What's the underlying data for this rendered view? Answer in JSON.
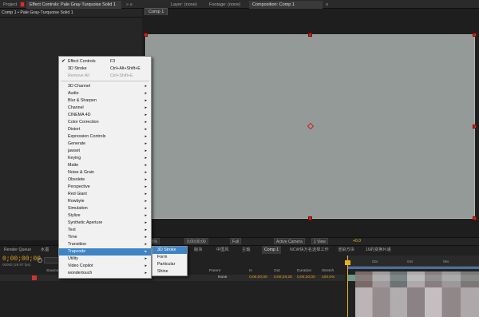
{
  "top_tabs": {
    "project": "Project",
    "effect_controls": "Effect Controls: Pale Gray-Turquoise Solid 1",
    "effect_controls_extra": "» ≡",
    "layer": "Layer: (none)",
    "footage": "Footage: (none)",
    "composition": "Composition: Comp 1",
    "composition_extra": "≡"
  },
  "breadcrumb": "Comp 1 • Pale Gray-Turquoise Solid 1",
  "comp_subtab": "Comp 1",
  "context_menu": {
    "top_items": [
      {
        "label": "Effect Controls",
        "shortcut": "F3",
        "checked": true,
        "disabled": false
      },
      {
        "label": "3D Stroke",
        "shortcut": "Ctrl+Alt+Shift+E",
        "checked": false,
        "disabled": false
      },
      {
        "label": "Remove All",
        "shortcut": "Ctrl+Shift+E",
        "checked": false,
        "disabled": true
      }
    ],
    "categories": [
      "3D Channel",
      "Audio",
      "Blur & Sharpen",
      "Channel",
      "CINEMA 4D",
      "Color Correction",
      "Distort",
      "Expression Controls",
      "Generate",
      "jawset",
      "Keying",
      "Matte",
      "Noise & Grain",
      "Obsolete",
      "Perspective",
      "Red Giant",
      "Rowbyte",
      "Simulation",
      "Stylize",
      "Synthetic Aperture",
      "Text",
      "Time",
      "Transition",
      "Trapcode",
      "Utility",
      "Video Copilot",
      "wondertouch"
    ],
    "highlighted": "Trapcode",
    "arrow": "▸",
    "check": "✔"
  },
  "submenu": {
    "items": [
      "3D Stroke",
      "Form",
      "Particular",
      "Shine"
    ],
    "highlighted": "3D Stroke"
  },
  "viewer_bar": {
    "zoom": "25%",
    "timecode": "0;00;00;00",
    "resolution": "Full",
    "camera": "Active Camera",
    "views": "1 View",
    "exposure": "+0.0"
  },
  "render_queue": "Render Queue",
  "timeline_tabs": [
    "水墨",
    "水墨片头",
    "版块",
    "中国风",
    "主轴",
    "Comp 1",
    "NCW快万名选择工作",
    "渲染方块",
    "16的变换片递"
  ],
  "timecode": "0;00;00;00",
  "timecode_sub": "00000 (29.97 fps)",
  "columns": {
    "source": "Source Name",
    "parent": "Parent",
    "in": "In",
    "out": "Out",
    "duration": "Duration",
    "stretch": "Stretch"
  },
  "layer_row": {
    "parent": "None",
    "in": "0;00;00;00",
    "out": "0;00;29;29",
    "duration": "0;00;30;00",
    "stretch": "100.0%"
  },
  "ruler": [
    "02s",
    "04s",
    "06s"
  ],
  "colors": {
    "comp_bg": "#939a98",
    "handle": "#d0201e",
    "highlight": "#3d85c6",
    "timecode_orange": "#e6a11a"
  }
}
